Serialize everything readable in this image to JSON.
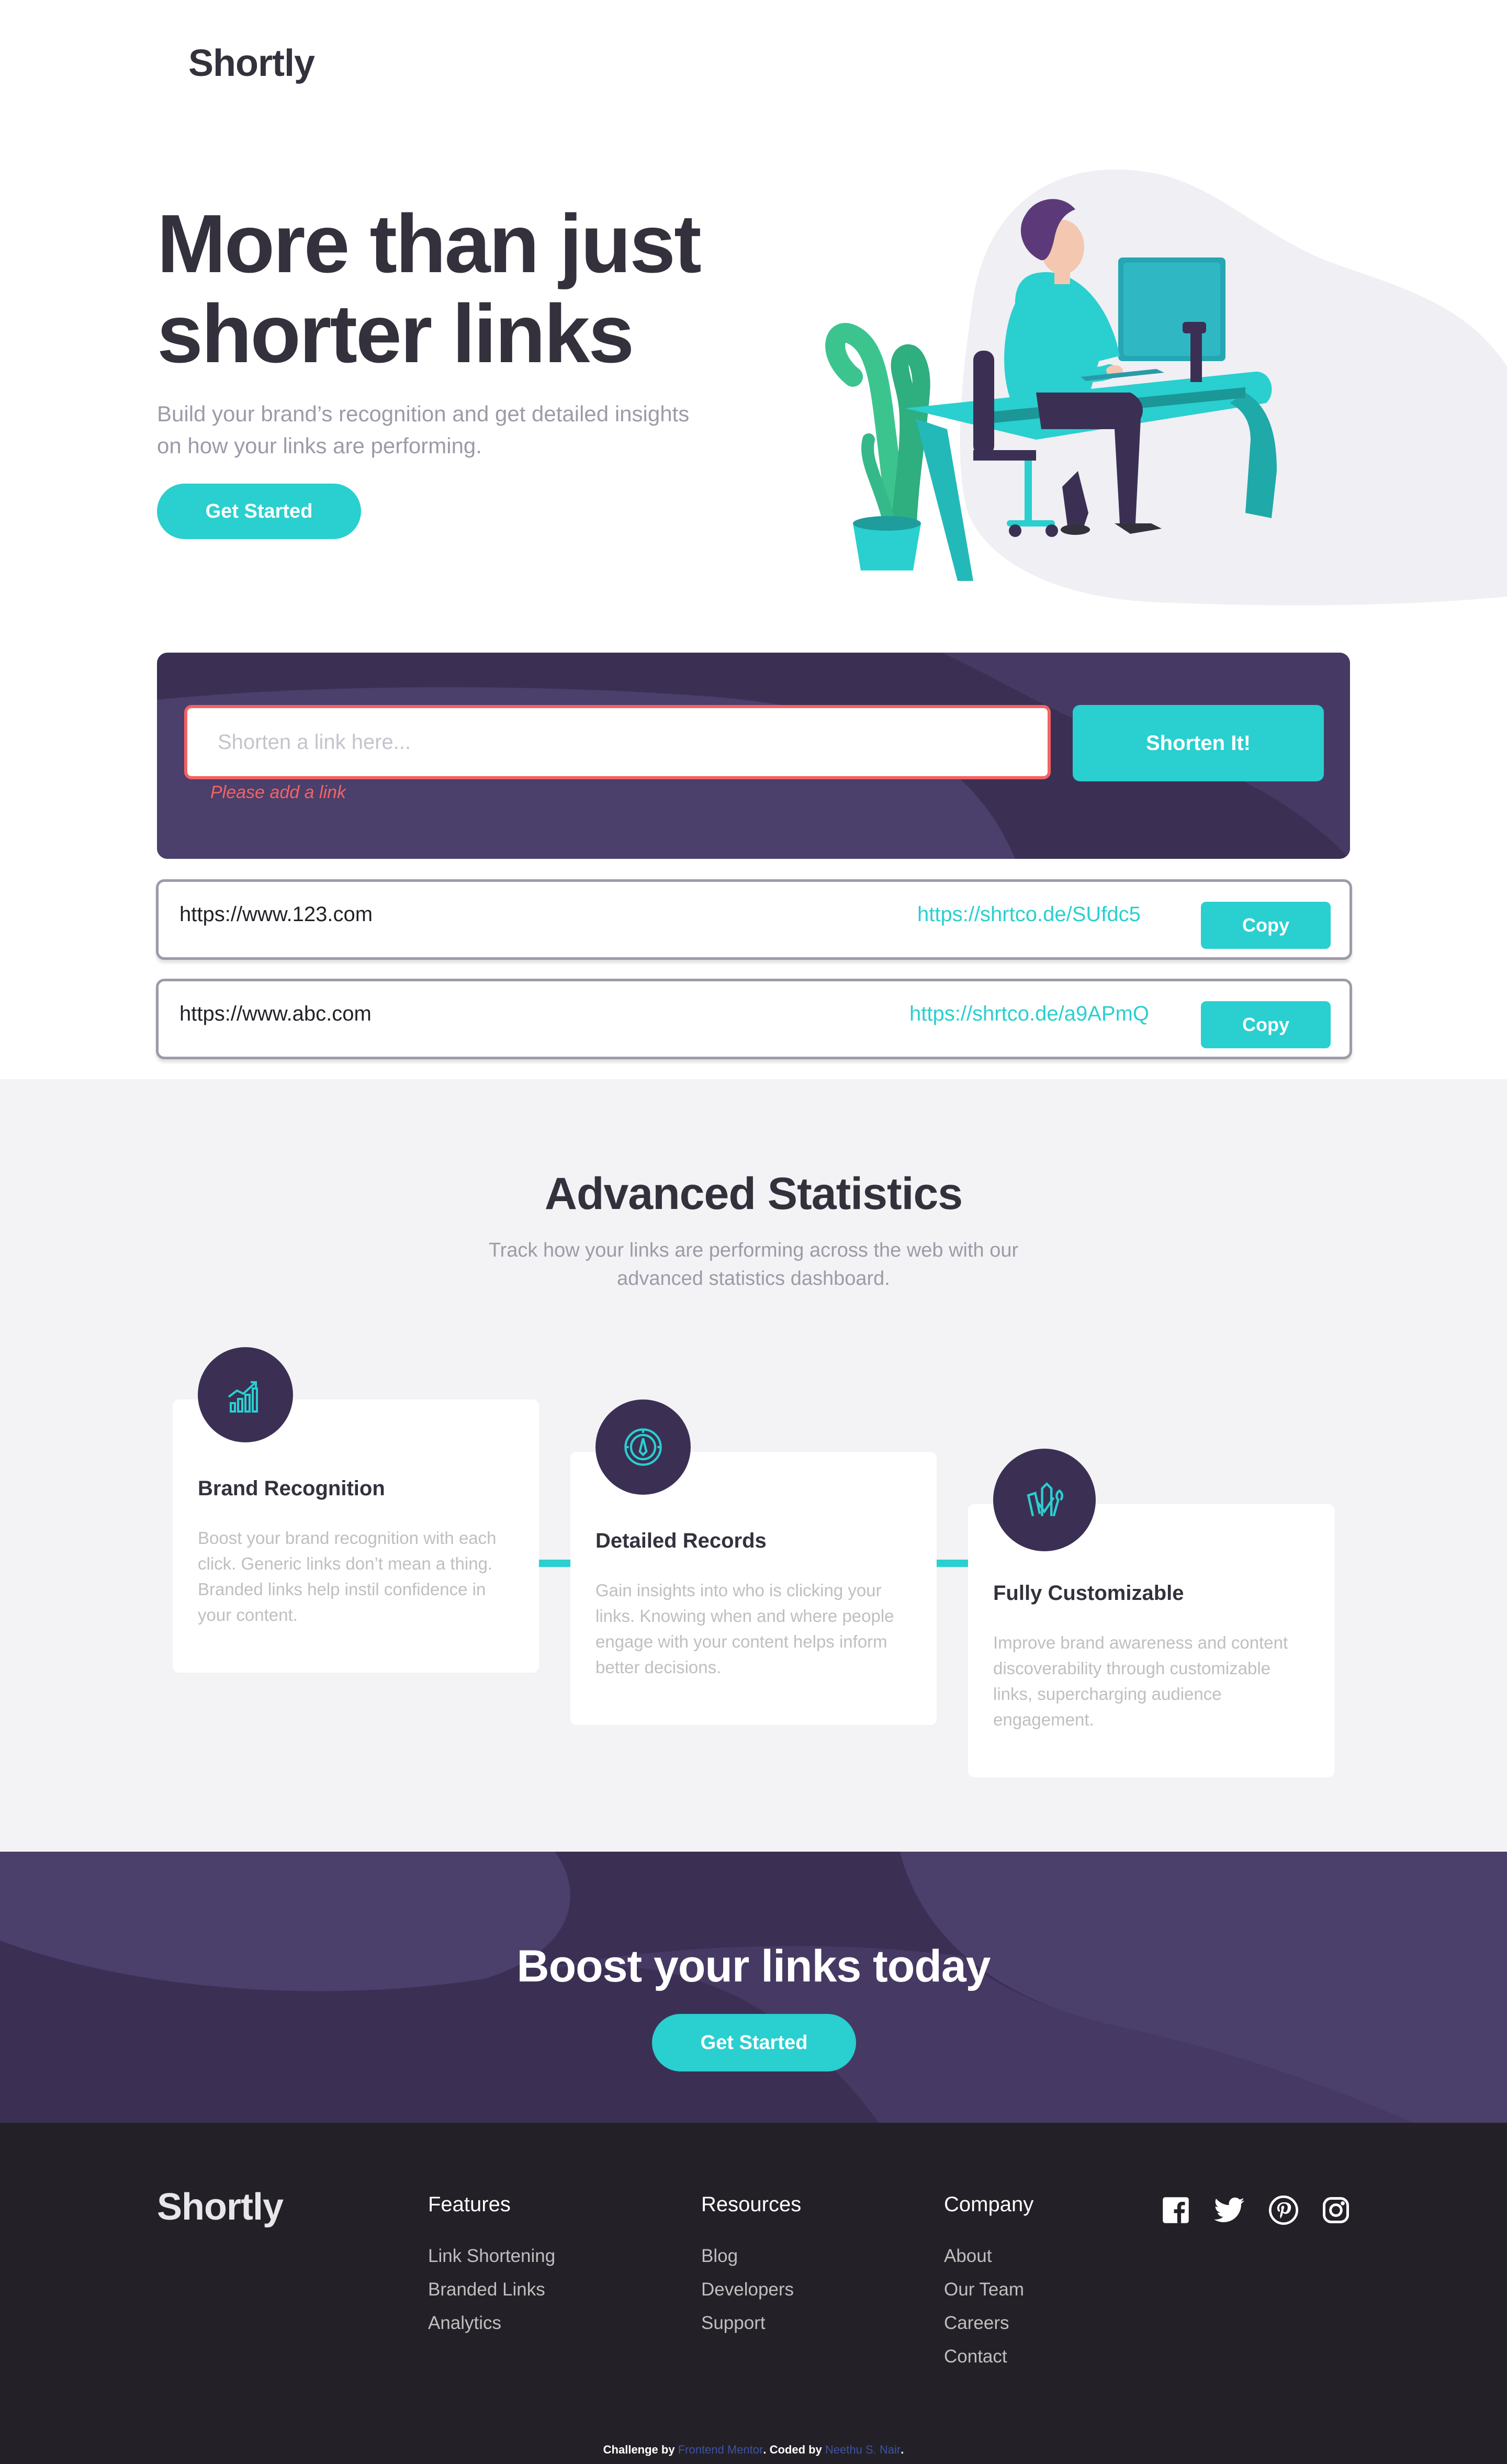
{
  "header": {
    "logo": "Shortly"
  },
  "hero": {
    "title": "More than just shorter links",
    "subtitle": "Build your brand’s recognition and get detailed insights on how your links are performing.",
    "cta_label": "Get Started"
  },
  "shorten": {
    "placeholder": "Shorten a link here...",
    "error": "Please add a link",
    "button_label": "Shorten It!"
  },
  "results": [
    {
      "original": "https://www.123.com",
      "short": "https://shrtco.de/SUfdc5",
      "copy_label": "Copy"
    },
    {
      "original": "https://www.abc.com",
      "short": "https://shrtco.de/a9APmQ",
      "copy_label": "Copy"
    }
  ],
  "stats": {
    "title": "Advanced Statistics",
    "subtitle": "Track how your links are performing across the web with our advanced statistics dashboard.",
    "cards": [
      {
        "icon": "brand-recognition-icon",
        "title": "Brand Recognition",
        "text": "Boost your brand recognition with each click. Generic links don’t mean a thing. Branded links help instil confidence in your content."
      },
      {
        "icon": "detailed-records-icon",
        "title": "Detailed Records",
        "text": "Gain insights into who is clicking your links. Knowing when and where people engage with your content helps inform better decisions."
      },
      {
        "icon": "fully-customizable-icon",
        "title": "Fully Customizable",
        "text": "Improve brand awareness and content discoverability through customizable links, supercharging audience engagement."
      }
    ]
  },
  "boost": {
    "title": "Boost your links today",
    "cta_label": "Get Started"
  },
  "footer": {
    "logo": "Shortly",
    "columns": [
      {
        "heading": "Features",
        "links": [
          "Link Shortening",
          "Branded Links",
          "Analytics"
        ]
      },
      {
        "heading": "Resources",
        "links": [
          "Blog",
          "Developers",
          "Support"
        ]
      },
      {
        "heading": "Company",
        "links": [
          "About",
          "Our Team",
          "Careers",
          "Contact"
        ]
      }
    ],
    "social": [
      "facebook-icon",
      "twitter-icon",
      "pinterest-icon",
      "instagram-icon"
    ],
    "attribution": {
      "prefix": "Challenge by ",
      "challenge_link": "Frontend Mentor",
      "middle": ". Coded by ",
      "author_link": "Neethu S. Nair",
      "suffix": "."
    }
  },
  "colors": {
    "primary": "#2acfcf",
    "dark_violet": "#3b3054",
    "red": "#f46262",
    "very_dark_violet": "#232127",
    "gray": "#9e9aa7",
    "light_bg": "#f3f3f5"
  }
}
